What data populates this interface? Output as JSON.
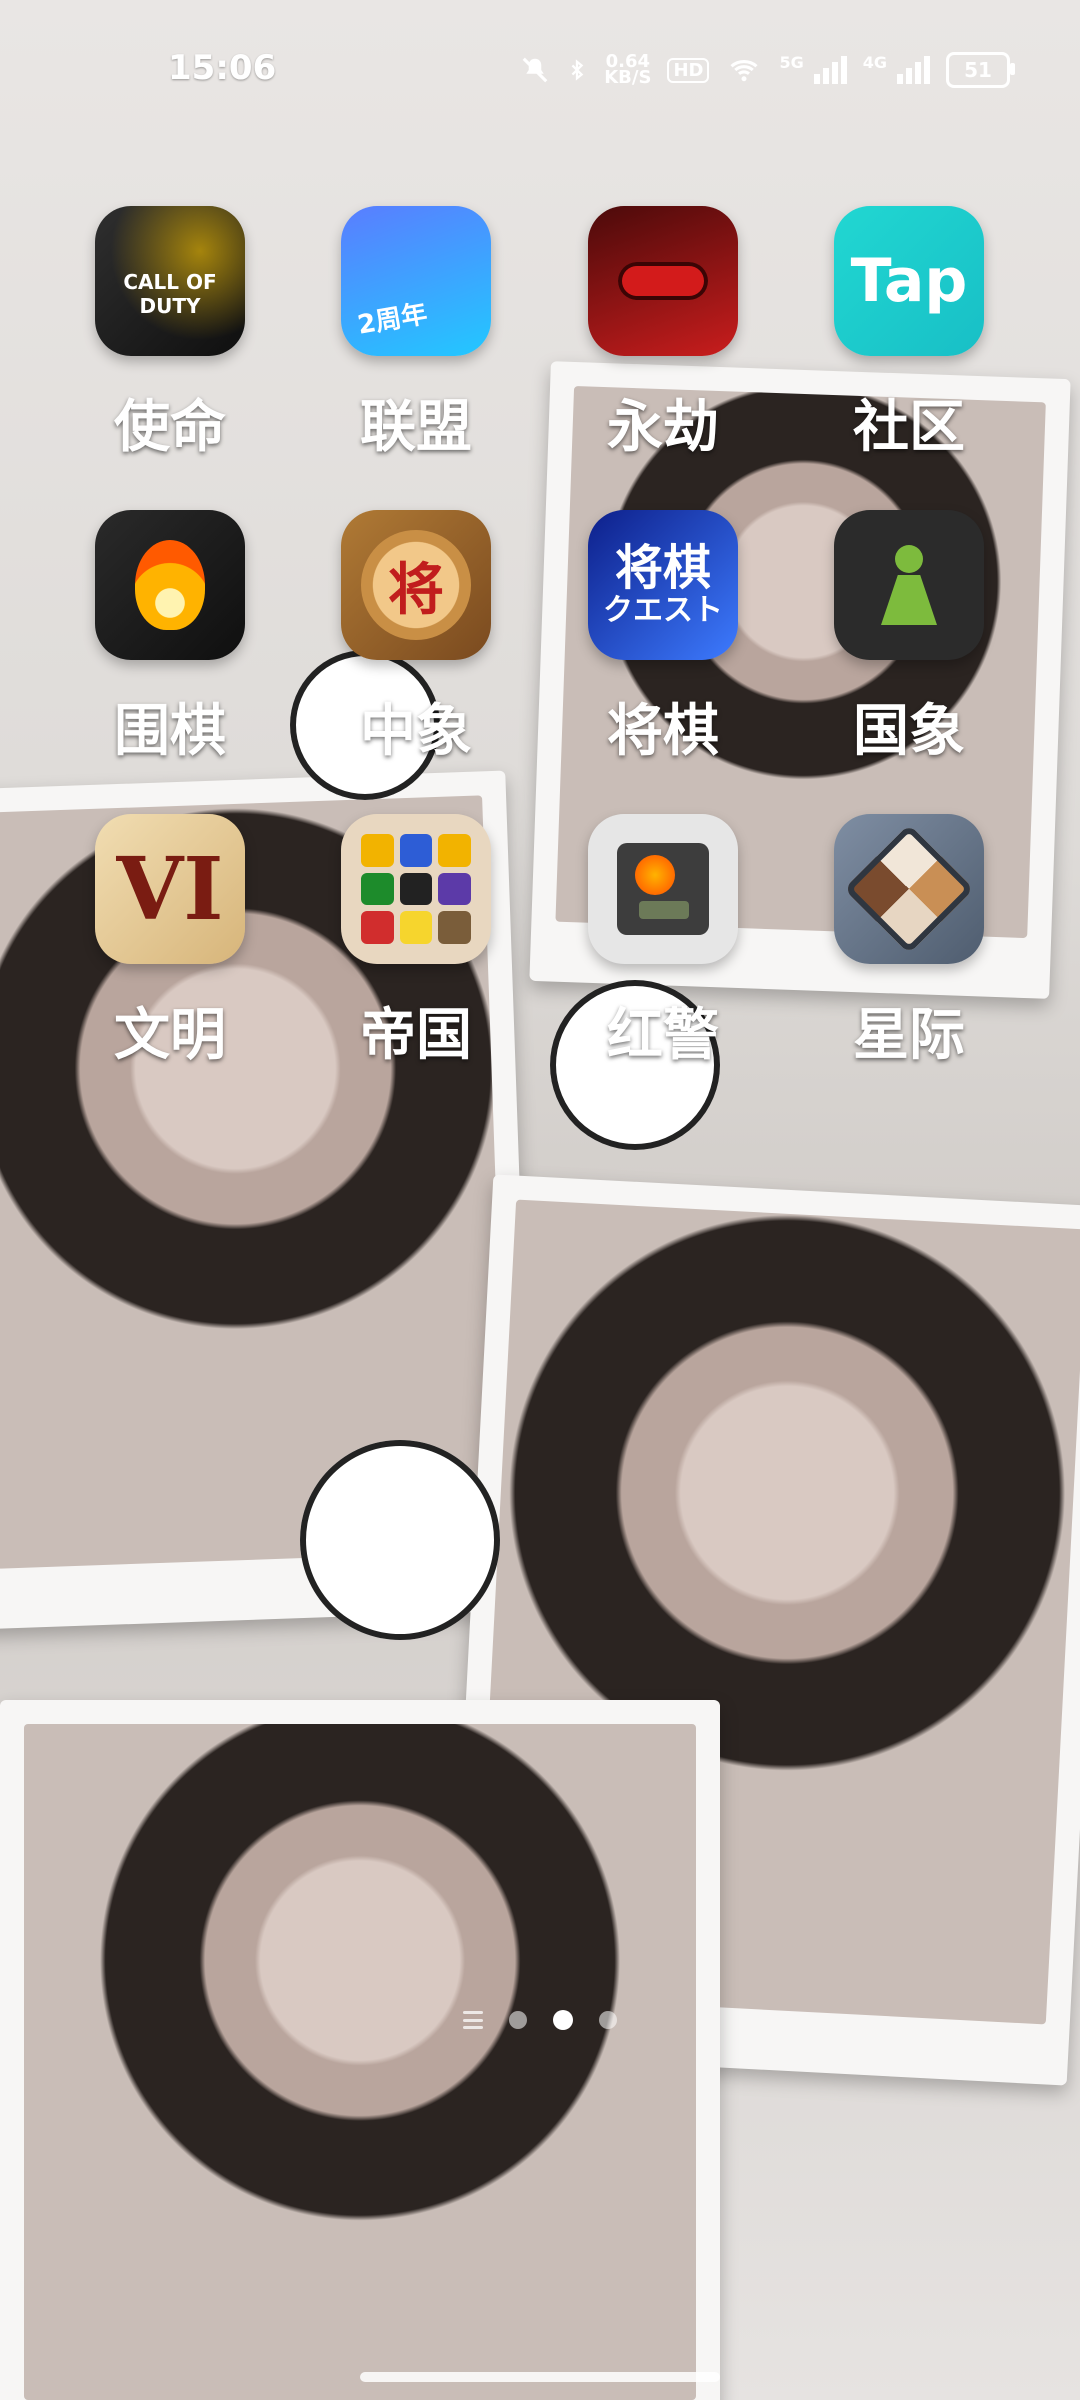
{
  "status_bar": {
    "time": "15:06",
    "speed_value": "0.64",
    "speed_unit": "KB/S",
    "hd_label": "HD",
    "net_5g": "5G",
    "net_4g": "4G",
    "battery": "51",
    "icons": [
      "mute-bell-icon",
      "bluetooth-icon",
      "wifi-icon",
      "signal-icon"
    ]
  },
  "apps": [
    {
      "label": "使命",
      "icon": "call-of-duty-icon"
    },
    {
      "label": "联盟",
      "icon": "league-icon"
    },
    {
      "label": "永劫",
      "icon": "naraka-icon"
    },
    {
      "label": "社区",
      "icon": "tap-icon",
      "icon_text": "Tap"
    },
    {
      "label": "围棋",
      "icon": "go-icon"
    },
    {
      "label": "中象",
      "icon": "chinese-chess-icon",
      "icon_text": "将"
    },
    {
      "label": "将棋",
      "icon": "shogi-icon",
      "icon_text_1": "将棋",
      "icon_text_2": "クエスト"
    },
    {
      "label": "国象",
      "icon": "chess-icon"
    },
    {
      "label": "文明",
      "icon": "civilization-icon",
      "icon_text": "VI"
    },
    {
      "label": "帝国",
      "icon": "empires-icon"
    },
    {
      "label": "红警",
      "icon": "red-alert-icon"
    },
    {
      "label": "星际",
      "icon": "starcraft-icon"
    }
  ],
  "icon_texts": {
    "cod_text": "CALL OF DUTY",
    "lol_text": "2周年"
  },
  "page_indicator": {
    "pages": 3,
    "active": 2
  }
}
